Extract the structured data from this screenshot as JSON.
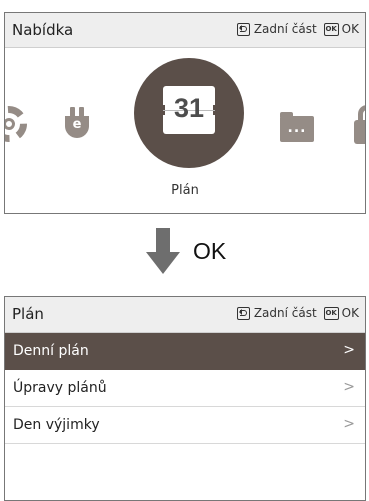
{
  "top_screen": {
    "header": {
      "title": "Nabídka",
      "back_label": "Zadní část",
      "ok_badge": "OK",
      "ok_label": "OK"
    },
    "carousel": {
      "items": [
        {
          "icon": "gear-icon"
        },
        {
          "icon": "plug-icon",
          "glyph": "e"
        },
        {
          "icon": "calendar-icon",
          "day": "31",
          "label": "Plán",
          "selected": true
        },
        {
          "icon": "folder-icon",
          "glyph": "..."
        },
        {
          "icon": "lock-icon"
        }
      ]
    }
  },
  "transition": {
    "arrow_icon": "arrow-down-icon",
    "label": "OK"
  },
  "bottom_screen": {
    "header": {
      "title": "Plán",
      "back_label": "Zadní část",
      "ok_badge": "OK",
      "ok_label": "OK"
    },
    "menu": [
      {
        "label": "Denní plán",
        "chevron": ">",
        "selected": true
      },
      {
        "label": "Úpravy plánů",
        "chevron": ">",
        "selected": false
      },
      {
        "label": "Den výjimky",
        "chevron": ">",
        "selected": false
      }
    ]
  },
  "colors": {
    "accent": "#5b4f49",
    "icon_gray": "#958c86",
    "header_bg": "#eeeeee"
  }
}
